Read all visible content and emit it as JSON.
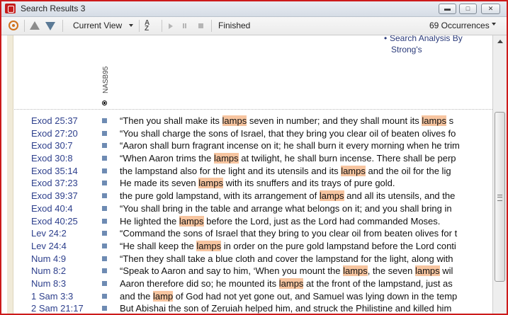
{
  "window": {
    "title": "Search Results 3"
  },
  "toolbar": {
    "view_label": "Current View",
    "sort_label": "A Z",
    "status": "Finished",
    "occurrences": "69 Occurrences"
  },
  "sidebar_link": {
    "line1": "Search Analysis By",
    "line2": "Strong's"
  },
  "column": {
    "version": "NASB95"
  },
  "rows": [
    {
      "ref": "Exod 25:37",
      "parts": [
        [
          "“Then you shall make its ",
          0
        ],
        [
          "lamps",
          1
        ],
        [
          " seven in number; and they shall mount its ",
          0
        ],
        [
          "lamps",
          1
        ],
        [
          " s",
          0
        ]
      ]
    },
    {
      "ref": "Exod 27:20",
      "parts": [
        [
          "“You shall charge the sons of Israel, that they bring you clear oil of beaten olives fo",
          0
        ]
      ]
    },
    {
      "ref": "Exod 30:7",
      "parts": [
        [
          "“Aaron shall burn fragrant incense on it; he shall burn it every morning when he trim",
          0
        ]
      ]
    },
    {
      "ref": "Exod 30:8",
      "parts": [
        [
          "“When Aaron trims the ",
          0
        ],
        [
          "lamps",
          1
        ],
        [
          " at twilight, he shall burn incense. There shall be perp",
          0
        ]
      ]
    },
    {
      "ref": "Exod 35:14",
      "parts": [
        [
          "the lampstand also for the light and its utensils and its ",
          0
        ],
        [
          "lamps",
          1
        ],
        [
          " and the oil for the lig",
          0
        ]
      ]
    },
    {
      "ref": "Exod 37:23",
      "parts": [
        [
          "He made its seven ",
          0
        ],
        [
          "lamps",
          1
        ],
        [
          " with its snuffers and its trays of pure gold.",
          0
        ]
      ]
    },
    {
      "ref": "Exod 39:37",
      "parts": [
        [
          "the pure gold lampstand, with its arrangement of ",
          0
        ],
        [
          "lamps",
          1
        ],
        [
          " and all its utensils, and the",
          0
        ]
      ]
    },
    {
      "ref": "Exod 40:4",
      "parts": [
        [
          "“You shall bring in the table and arrange what belongs on it; and you shall bring in",
          0
        ]
      ]
    },
    {
      "ref": "Exod 40:25",
      "parts": [
        [
          "He lighted the ",
          0
        ],
        [
          "lamps",
          1
        ],
        [
          " before the Lord, just as the Lord had commanded Moses.",
          0
        ]
      ]
    },
    {
      "ref": "Lev 24:2",
      "parts": [
        [
          "“Command the sons of Israel that they bring to you clear oil from beaten olives for t",
          0
        ]
      ]
    },
    {
      "ref": "Lev 24:4",
      "parts": [
        [
          "“He shall keep the ",
          0
        ],
        [
          "lamps",
          1
        ],
        [
          " in order on the pure gold lampstand before the Lord conti",
          0
        ]
      ]
    },
    {
      "ref": "Num 4:9",
      "parts": [
        [
          "“Then they shall take a blue cloth and cover the lampstand for the light, along with",
          0
        ]
      ]
    },
    {
      "ref": "Num 8:2",
      "parts": [
        [
          "“Speak to Aaron and say to him, ‘When you mount the ",
          0
        ],
        [
          "lamps",
          1
        ],
        [
          ", the seven ",
          0
        ],
        [
          "lamps",
          1
        ],
        [
          " wil",
          0
        ]
      ]
    },
    {
      "ref": "Num 8:3",
      "parts": [
        [
          "Aaron therefore did so; he mounted its ",
          0
        ],
        [
          "lamps",
          1
        ],
        [
          " at the front of the lampstand, just as",
          0
        ]
      ]
    },
    {
      "ref": "1 Sam 3:3",
      "parts": [
        [
          "and the ",
          0
        ],
        [
          "lamp",
          1
        ],
        [
          " of God had not yet gone out, and Samuel was lying down in the temp",
          0
        ]
      ]
    },
    {
      "ref": "2 Sam 21:17",
      "parts": [
        [
          "But Abishai the son of Zeruiah helped him, and struck the Philistine and killed him",
          0
        ]
      ]
    }
  ],
  "icons": {
    "app": "logos-app-icon",
    "options": "gear-icon",
    "prev": "arrow-up-icon",
    "next": "arrow-down-icon",
    "sort": "sort-az-icon",
    "play": "play-icon",
    "pause": "pause-icon",
    "stop": "stop-icon"
  },
  "colors": {
    "highlight": "#f7c5a0",
    "reference": "#2d3f8c",
    "marker": "#6e8bb3",
    "frame": "#cc1a1a"
  }
}
